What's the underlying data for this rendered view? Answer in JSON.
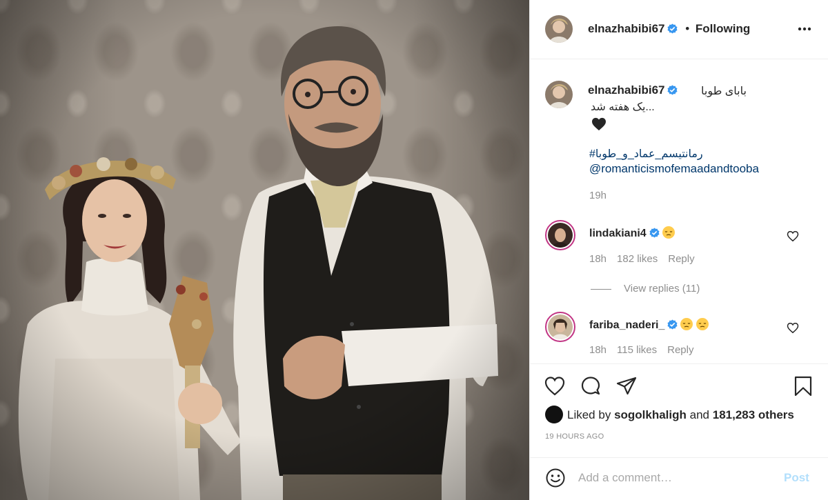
{
  "post": {
    "username": "elnazhabibi67",
    "follow_separator": "•",
    "follow_status": "Following"
  },
  "caption": {
    "username": "elnazhabibi67",
    "title": "بابای طوبا",
    "line2": "...یک هفته شد",
    "heart_emoji": "black-heart",
    "hashtag": "#رمانتیسم_عماد_و_طوبا",
    "mention": "@romanticismofemaadandtooba",
    "time": "19h"
  },
  "comments": [
    {
      "username": "lindakiani4",
      "emoji": [
        "pensive-face"
      ],
      "time": "18h",
      "likes": "182 likes",
      "reply": "Reply"
    },
    {
      "username": "fariba_naderi_",
      "emoji": [
        "pensive-face",
        "pensive-face"
      ],
      "time": "18h",
      "likes": "115 likes",
      "reply": "Reply"
    }
  ],
  "view_replies": "View replies (11)",
  "likes_summary": {
    "prefix": "Liked by",
    "user": "sogolkhaligh",
    "middle": "and",
    "others": "181,283 others"
  },
  "post_time": "19 HOURS AGO",
  "comment_box": {
    "placeholder": "Add a comment…",
    "post_label": "Post"
  },
  "colors": {
    "link": "#00376b",
    "verified": "#3897f0",
    "post_disabled": "#b2dffc",
    "muted": "#8e8e8e"
  },
  "icons": [
    "verified-badge-icon",
    "more-options-icon",
    "heart-icon",
    "comment-icon",
    "share-icon",
    "bookmark-icon",
    "emoji-icon"
  ]
}
